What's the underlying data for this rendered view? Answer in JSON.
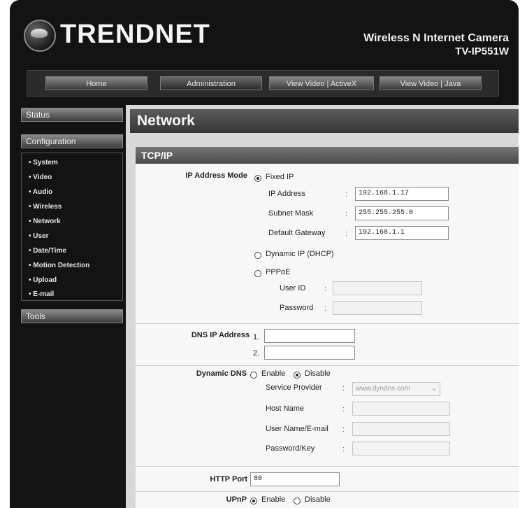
{
  "header": {
    "brand": "TRENDNET",
    "product_line": "Wireless N Internet Camera",
    "model": "TV-IP551W",
    "logo_icon": "trendnet-globe-icon"
  },
  "nav": {
    "tabs": [
      {
        "label": "Home"
      },
      {
        "label": "Administration"
      },
      {
        "label": "View Video | ActiveX"
      },
      {
        "label": "View Video | Java"
      }
    ]
  },
  "sidebar": {
    "status": "Status",
    "configuration": "Configuration",
    "tools": "Tools",
    "items": [
      "System",
      "Video",
      "Audio",
      "Wireless",
      "Network",
      "User",
      "Date/Time",
      "Motion Detection",
      "Upload",
      "E-mail"
    ]
  },
  "page": {
    "title": "Network",
    "section": "TCP/IP"
  },
  "ip_mode": {
    "label": "IP Address Mode",
    "fixed_ip": "Fixed IP",
    "ip_address_label": "IP Address",
    "ip_address": "192.168.1.17",
    "subnet_mask_label": "Subnet Mask",
    "subnet_mask": "255.255.255.0",
    "gateway_label": "Default Gateway",
    "gateway": "192.168.1.1",
    "dhcp": "Dynamic IP (DHCP)",
    "pppoe": "PPPoE",
    "user_id_label": "User ID",
    "password_label": "Password",
    "selected": "Fixed IP"
  },
  "dns": {
    "label": "DNS IP Address",
    "n1": "1.",
    "n2": "2.",
    "dns1": "",
    "dns2": ""
  },
  "ddns": {
    "label": "Dynamic DNS",
    "enable": "Enable",
    "disable": "Disable",
    "selected": "Disable",
    "service_provider_label": "Service Provider",
    "service_provider": "www.dyndns.com",
    "host_name_label": "Host Name",
    "user_name_label": "User Name/E-mail",
    "password_key_label": "Password/Key"
  },
  "http": {
    "label": "HTTP Port",
    "port": "80"
  },
  "upnp": {
    "label": "UPnP",
    "enable": "Enable",
    "disable": "Disable",
    "selected": "Enable"
  },
  "colors": {
    "frame": "#131313",
    "panel": "#f7f7f7",
    "bar": "#4a4a4a"
  }
}
